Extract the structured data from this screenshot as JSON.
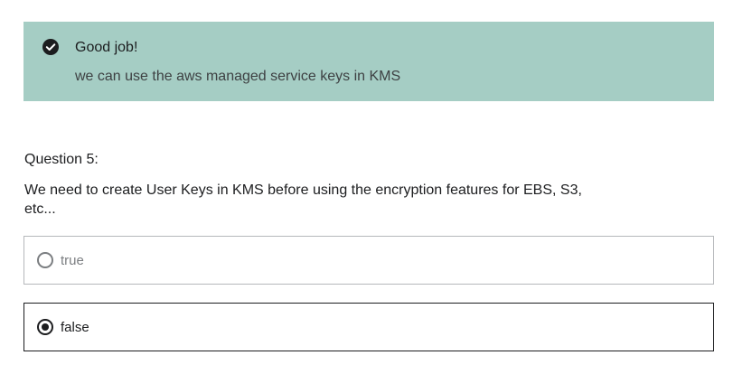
{
  "feedback": {
    "icon": "check-circle-icon",
    "title": "Good job!",
    "message": "we can use the aws managed service keys in KMS",
    "background_color": "#a5cdc4"
  },
  "question": {
    "label": "Question 5:",
    "text": "We need to create User Keys in KMS before using the encryption features for EBS, S3, etc..."
  },
  "options": [
    {
      "label": "true",
      "selected": false
    },
    {
      "label": "false",
      "selected": true
    }
  ]
}
